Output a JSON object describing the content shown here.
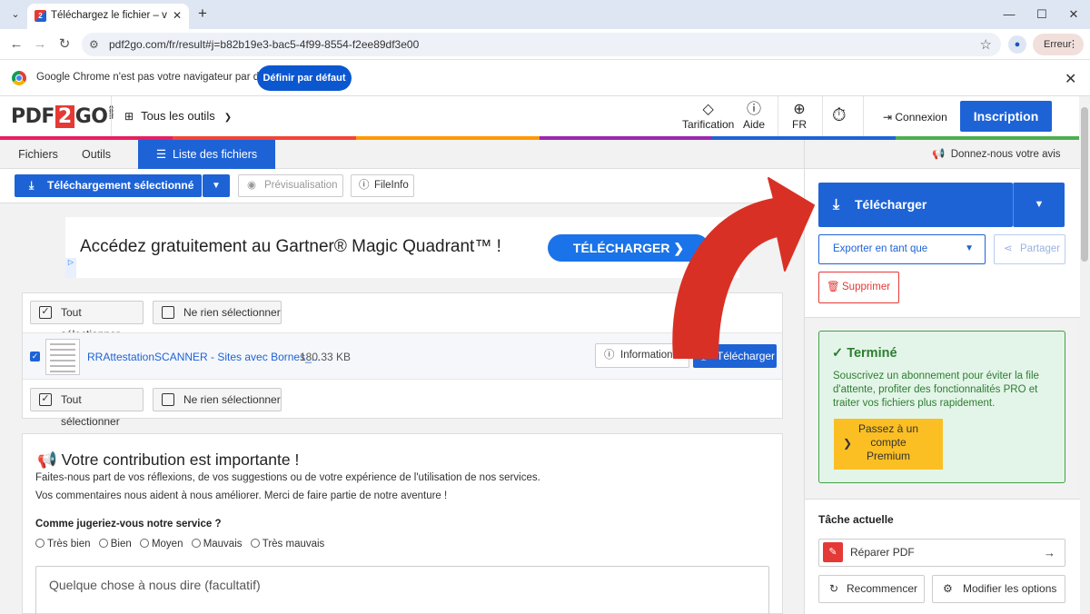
{
  "browser": {
    "tab_title": "Téléchargez le fichier – votre co",
    "url": "pdf2go.com/fr/result#j=b82b19e3-bac5-4f99-8554-f2ee89df3e00",
    "profile_chip": "Erreur",
    "infobar_text": "Google Chrome n'est pas votre navigateur par défaut",
    "infobar_button": "Définir par défaut"
  },
  "site": {
    "logo_left": "PDF",
    "logo_mid": "2",
    "logo_right": "GO",
    "logo_suffix": "com",
    "tools_menu": "Tous les outils",
    "pricing": "Tarification",
    "help": "Aide",
    "lang": "FR",
    "login": "Connexion",
    "signup": "Inscription"
  },
  "tabs": [
    "Fichiers",
    "Outils",
    "Liste des fichiers"
  ],
  "actionbar": {
    "download_selected": "Téléchargement sélectionné",
    "preview": "Prévisualisation",
    "fileinfo": "FileInfo"
  },
  "ad": {
    "text": "Accédez gratuitement au Gartner® Magic Quadrant™ !",
    "button": "TÉLÉCHARGER"
  },
  "file_panel": {
    "select_all": "Tout sélectionner",
    "select_none": "Ne rien sélectionner",
    "file_name": "RRAttestationSCANNER - Sites avec Bornes_...",
    "file_size": "180.33 KB",
    "info_button": "Informations",
    "download_button": "Télécharger"
  },
  "feedback": {
    "title": "Votre contribution est importante !",
    "line1": "Faites-nous part de vos réflexions, de vos suggestions ou de votre expérience de l'utilisation de nos services.",
    "line2": "Vos commentaires nous aident à nous améliorer. Merci de faire partie de notre aventure !",
    "question": "Comme jugeriez-vous notre service ?",
    "options": [
      "Très bien",
      "Bien",
      "Moyen",
      "Mauvais",
      "Très mauvais"
    ],
    "placeholder": "Quelque chose à nous dire (facultatif)"
  },
  "right_panel": {
    "feedback_link": "Donnez-nous votre avis",
    "download": "Télécharger",
    "export_as": "Exporter en tant que",
    "share": "Partager",
    "delete": "Supprimer",
    "done_title": "Terminé",
    "done_text_1": "Souscrivez un abonnement pour éviter la file",
    "done_text_2": "d'attente, profiter des fonctionnalités PRO et",
    "done_text_3": "traiter vos fichiers plus rapidement.",
    "premium_1": "Passez à un",
    "premium_2": "compte",
    "premium_3": "Premium",
    "current_task": "Tâche actuelle",
    "task_name": "Réparer PDF",
    "restart": "Recommencer",
    "modify_options": "Modifier les options"
  },
  "colors": {
    "primary": "#1e63d6",
    "danger": "#e53935",
    "success_bg": "#e3f5e8",
    "premium": "#fbbf24",
    "arrow": "#d93025"
  }
}
